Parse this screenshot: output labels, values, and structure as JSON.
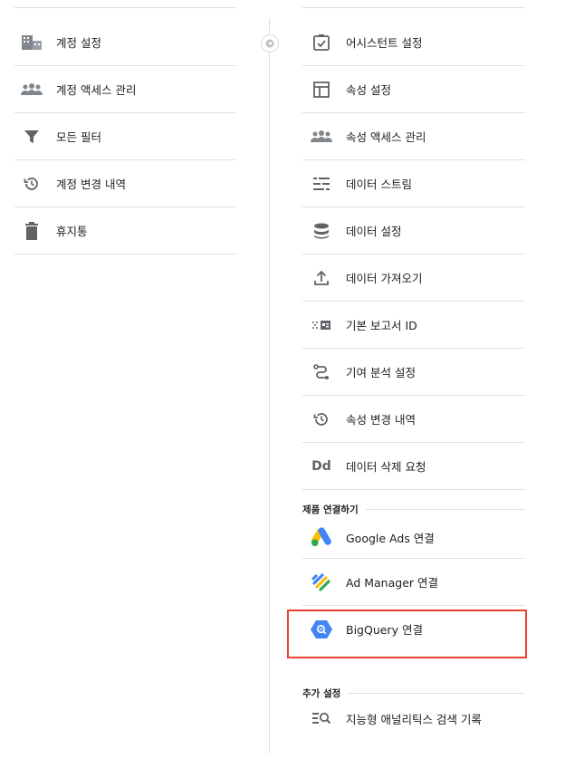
{
  "left_menu": {
    "items": [
      {
        "label": "계정 설정",
        "icon": "building-icon"
      },
      {
        "label": "계정 액세스 관리",
        "icon": "people-icon"
      },
      {
        "label": "모든 필터",
        "icon": "filter-icon"
      },
      {
        "label": "계정 변경 내역",
        "icon": "history-icon"
      },
      {
        "label": "휴지통",
        "icon": "trash-icon"
      }
    ]
  },
  "right_menu": {
    "items": [
      {
        "label": "어시스턴트 설정",
        "icon": "checkbox-icon"
      },
      {
        "label": "속성 설정",
        "icon": "window-icon"
      },
      {
        "label": "속성 액세스 관리",
        "icon": "people-icon"
      },
      {
        "label": "데이터 스트림",
        "icon": "streams-icon"
      },
      {
        "label": "데이터 설정",
        "icon": "database-icon"
      },
      {
        "label": "데이터 가져오기",
        "icon": "upload-icon"
      },
      {
        "label": "기본 보고서 ID",
        "icon": "id-card-icon"
      },
      {
        "label": "기여 분석 설정",
        "icon": "path-icon"
      },
      {
        "label": "속성 변경 내역",
        "icon": "history-icon"
      },
      {
        "label": "데이터 삭제 요청",
        "icon": "dd-icon"
      }
    ],
    "product_links_heading": "제품 연결하기",
    "product_links": [
      {
        "label": "Google Ads 연결",
        "icon": "google-ads-icon"
      },
      {
        "label": "Ad Manager 연결",
        "icon": "ad-manager-icon"
      },
      {
        "label": "BigQuery 연결",
        "icon": "bigquery-icon"
      }
    ],
    "additional_heading": "추가 설정",
    "additional_items": [
      {
        "label": "지능형 애널리틱스 검색 기록",
        "icon": "search-history-icon"
      }
    ]
  },
  "colors": {
    "highlight": "#e9432f",
    "icon_gray": "#5f6368",
    "bigquery_blue": "#4285f4"
  }
}
